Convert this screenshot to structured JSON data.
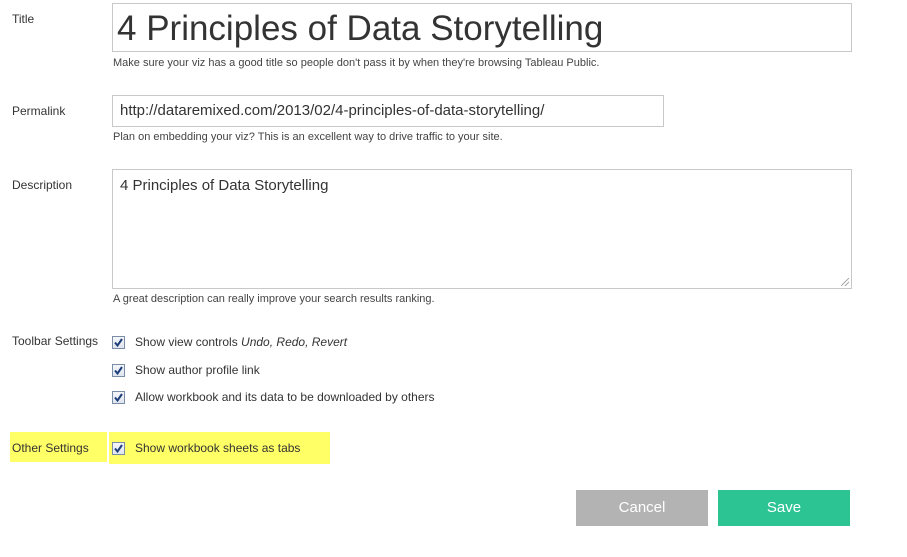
{
  "title_field": {
    "label": "Title",
    "value": "4 Principles of Data Storytelling",
    "hint": "Make sure your viz has a good title so people don't pass it by when they're browsing Tableau Public."
  },
  "permalink_field": {
    "label": "Permalink",
    "value": "http://dataremixed.com/2013/02/4-principles-of-data-storytelling/",
    "hint": "Plan on embedding your viz? This is an excellent way to drive traffic to your site."
  },
  "description_field": {
    "label": "Description",
    "value": "4 Principles of Data Storytelling",
    "hint": "A great description can really improve your search results ranking."
  },
  "toolbar_settings": {
    "label": "Toolbar Settings",
    "options": [
      {
        "prefix": "Show view controls ",
        "italic": "Undo, Redo, Revert",
        "checked": true
      },
      {
        "prefix": "Show author profile link",
        "italic": "",
        "checked": true
      },
      {
        "prefix": "Allow workbook and its data to be downloaded by others",
        "italic": "",
        "checked": true
      }
    ]
  },
  "other_settings": {
    "label": "Other Settings",
    "options": [
      {
        "prefix": "Show workbook sheets as tabs",
        "italic": "",
        "checked": true
      }
    ],
    "highlight_color": "#ffff66"
  },
  "actions": {
    "cancel_label": "Cancel",
    "save_label": "Save",
    "cancel_color": "#b3b3b3",
    "save_color": "#2dc493"
  }
}
